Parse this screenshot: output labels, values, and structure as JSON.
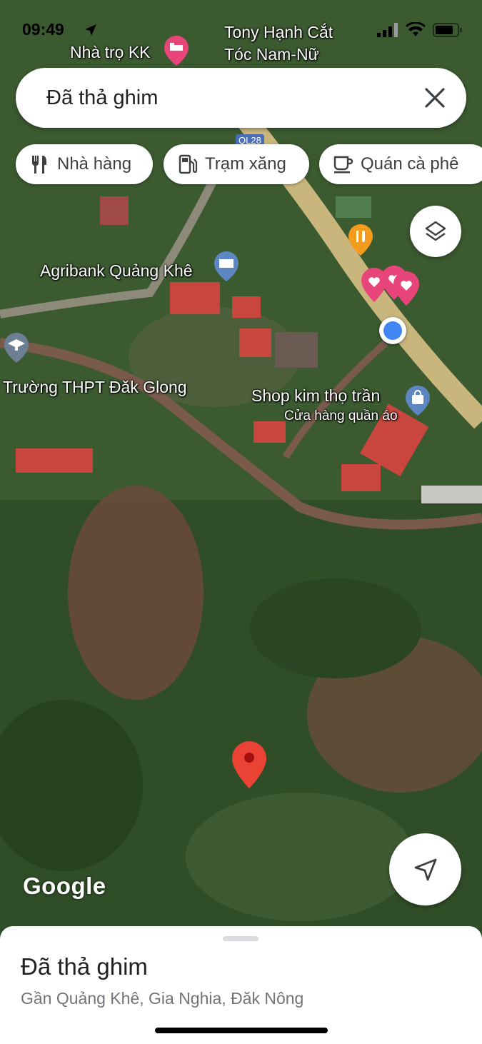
{
  "status_bar": {
    "time": "09:49"
  },
  "search": {
    "text": "Đã thả ghim"
  },
  "chips": [
    {
      "label": "Nhà hàng",
      "icon": "restaurant-icon"
    },
    {
      "label": "Trạm xăng",
      "icon": "gas-station-icon"
    },
    {
      "label": "Quán cà phê",
      "icon": "coffee-icon"
    }
  ],
  "map": {
    "labels": {
      "hotel": "Nhà trọ KK",
      "salon_line1": "Tony Hạnh Cắt",
      "salon_line2": "Tóc Nam-Nữ",
      "bank": "Agribank Quảng Khê",
      "school": "Trường THPT Đăk Glong",
      "shop": "Shop kim thọ trần",
      "shop_sub": "Cửa hàng quần áo",
      "road": "QL28"
    },
    "attribution": "Google"
  },
  "sheet": {
    "title": "Đã thả ghim",
    "address": "Gần Quảng Khê, Gia Nghia, Đăk Nông"
  },
  "colors": {
    "pin": "#ea4335",
    "location": "#4285f4",
    "heart": "#e8457a",
    "food": "#f29b1d",
    "poi_blue": "#5c87c2"
  }
}
